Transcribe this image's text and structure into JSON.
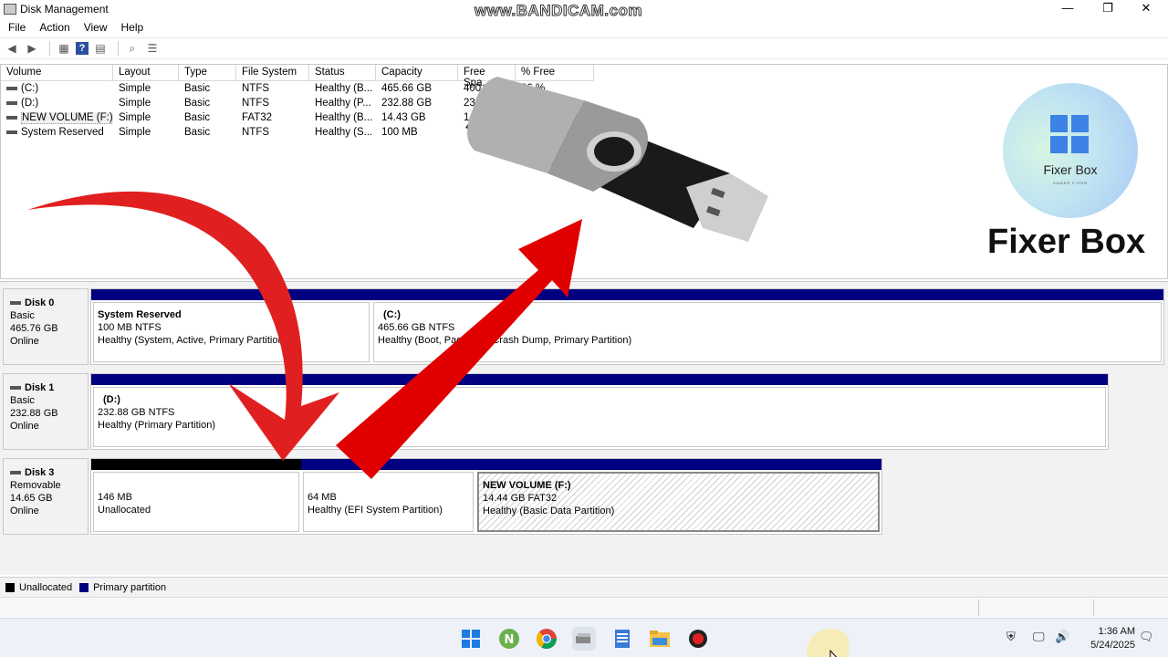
{
  "window": {
    "title": "Disk Management",
    "watermark": "www.BANDICAM.com",
    "minimize": "—",
    "maximize": "❐",
    "close": "✕"
  },
  "menu": [
    "File",
    "Action",
    "View",
    "Help"
  ],
  "volume_list": {
    "columns": [
      "Volume",
      "Layout",
      "Type",
      "File System",
      "Status",
      "Capacity",
      "Free Spa...",
      "% Free"
    ],
    "rows": [
      {
        "volume": "(C:)",
        "layout": "Simple",
        "type": "Basic",
        "fs": "NTFS",
        "status": "Healthy (B...",
        "capacity": "465.66 GB",
        "free": "400.87 G",
        "pct": "86 %"
      },
      {
        "volume": "(D:)",
        "layout": "Simple",
        "type": "Basic",
        "fs": "NTFS",
        "status": "Healthy (P...",
        "capacity": "232.88 GB",
        "free": "232.7",
        "pct": ""
      },
      {
        "volume": "NEW VOLUME (F:)",
        "layout": "Simple",
        "type": "Basic",
        "fs": "FAT32",
        "status": "Healthy (B...",
        "capacity": "14.43 GB",
        "free": "14",
        "pct": ""
      },
      {
        "volume": "System Reserved",
        "layout": "Simple",
        "type": "Basic",
        "fs": "NTFS",
        "status": "Healthy (S...",
        "capacity": "100 MB",
        "free": "",
        "pct": ""
      }
    ]
  },
  "disks": [
    {
      "name": "Disk 0",
      "kind": "Basic",
      "size": "465.76 GB",
      "state": "Online",
      "partitions": [
        {
          "name": "System Reserved",
          "line1": "100 MB NTFS",
          "line2": "Healthy (System, Active, Primary Partition)"
        },
        {
          "name": "(C:)",
          "line1": "465.66 GB NTFS",
          "line2": "Healthy (Boot, Page File, Crash Dump, Primary Partition)"
        }
      ]
    },
    {
      "name": "Disk 1",
      "kind": "Basic",
      "size": "232.88 GB",
      "state": "Online",
      "partitions": [
        {
          "name": "(D:)",
          "line1": "232.88 GB NTFS",
          "line2": "Healthy (Primary Partition)"
        }
      ]
    },
    {
      "name": "Disk 3",
      "kind": "Removable",
      "size": "14.65 GB",
      "state": "Online",
      "partitions": [
        {
          "name": "",
          "line1": "146 MB",
          "line2": "Unallocated"
        },
        {
          "name": "",
          "line1": "64 MB",
          "line2": "Healthy (EFI System Partition)"
        },
        {
          "name": "NEW VOLUME  (F:)",
          "line1": "14.44 GB FAT32",
          "line2": "Healthy (Basic Data Partition)"
        }
      ]
    }
  ],
  "legend": {
    "unallocated": "Unallocated",
    "primary": "Primary partition"
  },
  "colors": {
    "primary": "#000080",
    "unallocated": "#000000",
    "arrow": "#e02020"
  },
  "overlay": {
    "logo_text": "Fixer Box",
    "logo_subtext": "SAMER FIXER",
    "title": "Fixer Box"
  },
  "clock": {
    "time": "1:36 AM",
    "date": "5/24/2025"
  },
  "taskbar_icons": [
    "windows-start-icon",
    "notepad-plus-icon",
    "chrome-icon",
    "disk-management-icon",
    "notes-icon",
    "file-explorer-icon",
    "bandicam-record-icon"
  ]
}
